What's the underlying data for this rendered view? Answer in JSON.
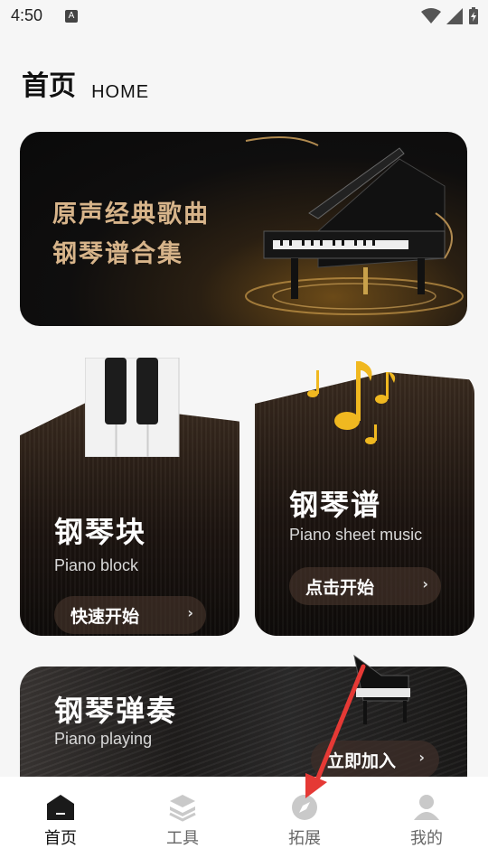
{
  "status": {
    "time": "4:50",
    "a_badge": "A"
  },
  "header": {
    "title": "首页",
    "subtitle": "HOME"
  },
  "banner": {
    "line1": "原声经典歌曲",
    "line2": "钢琴谱合集"
  },
  "cards": [
    {
      "title": "钢琴块",
      "subtitle": "Piano block",
      "button": "快速开始"
    },
    {
      "title": "钢琴谱",
      "subtitle": "Piano sheet music",
      "button": "点击开始"
    }
  ],
  "wide_card": {
    "title": "钢琴弹奏",
    "subtitle": "Piano playing",
    "button": "立即加入"
  },
  "tabbar": {
    "items": [
      {
        "label": "首页",
        "icon": "home-icon",
        "active": true
      },
      {
        "label": "工具",
        "icon": "layers-icon",
        "active": false
      },
      {
        "label": "拓展",
        "icon": "compass-icon",
        "active": false
      },
      {
        "label": "我的",
        "icon": "user-icon",
        "active": false
      }
    ]
  },
  "colors": {
    "accent_gold": "#d7b48a",
    "annotation_arrow": "#e53935"
  }
}
